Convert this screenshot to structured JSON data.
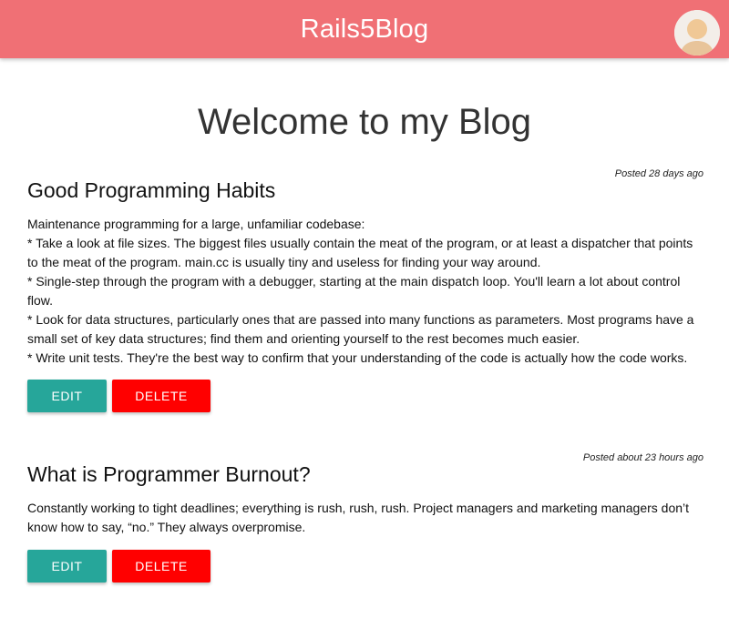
{
  "header": {
    "brand": "Rails5Blog",
    "colors": {
      "navbar": "#f07075",
      "edit": "#26a69a",
      "delete": "#ff0000"
    },
    "avatar_icon": "user-avatar-icon"
  },
  "main": {
    "title": "Welcome to my Blog"
  },
  "posts": [
    {
      "posted": "Posted 28 days ago",
      "title": "Good Programming Habits",
      "body": [
        "Maintenance programming for a large, unfamiliar codebase:",
        "* Take a look at file sizes. The biggest files usually contain the meat of the program, or at least a dispatcher that points to the meat of the program. main.cc is usually tiny and useless for finding your way around.",
        "* Single-step through the program with a debugger, starting at the main dispatch loop. You'll learn a lot about control flow.",
        "* Look for data structures, particularly ones that are passed into many functions as parameters. Most programs have a small set of key data structures; find them and orienting yourself to the rest becomes much easier.",
        "* Write unit tests. They're the best way to confirm that your understanding of the code is actually how the code works."
      ],
      "edit_label": "EDIT",
      "delete_label": "DELETE"
    },
    {
      "posted": "Posted about 23 hours ago",
      "title": "What is Programmer Burnout?",
      "body": [
        "Constantly working to tight deadlines; everything is rush, rush, rush. Project managers and marketing managers don’t know how to say, “no.” They always overpromise."
      ],
      "edit_label": "EDIT",
      "delete_label": "DELETE"
    }
  ]
}
